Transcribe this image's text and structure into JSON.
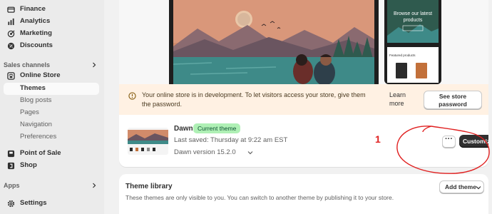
{
  "sidebar": {
    "items": [
      {
        "label": "Finance",
        "icon": "finance-icon"
      },
      {
        "label": "Analytics",
        "icon": "analytics-icon"
      },
      {
        "label": "Marketing",
        "icon": "marketing-icon"
      },
      {
        "label": "Discounts",
        "icon": "discounts-icon"
      }
    ],
    "sales_channels_label": "Sales channels",
    "online_store": "Online Store",
    "online_store_sub": [
      "Themes",
      "Blog posts",
      "Pages",
      "Navigation",
      "Preferences"
    ],
    "point_of_sale": "Point of Sale",
    "shop": "Shop",
    "apps_label": "Apps",
    "settings": "Settings"
  },
  "preview": {
    "mobile_headline": "Browse our latest products",
    "mobile_featured": "Featured products"
  },
  "banner": {
    "text": "Your online store is in development. To let visitors access your store, give them the password.",
    "learn_more": "Learn more",
    "see_store_password": "See store password"
  },
  "theme": {
    "name": "Dawn",
    "badge": "Current theme",
    "last_saved": "Last saved: Thursday at 9:22 am EST",
    "version": "Dawn version 15.2.0",
    "more_label": "···",
    "customize_label": "Customize"
  },
  "library": {
    "title": "Theme library",
    "description": "These themes are only visible to you. You can switch to another theme by publishing it to your store.",
    "add_theme": "Add theme"
  },
  "annotation": {
    "number": "1",
    "color": "#e02020"
  },
  "colors": {
    "badge_bg": "#aff0b5",
    "banner_bg": "#fff1e3",
    "primary_button": "#303030"
  }
}
